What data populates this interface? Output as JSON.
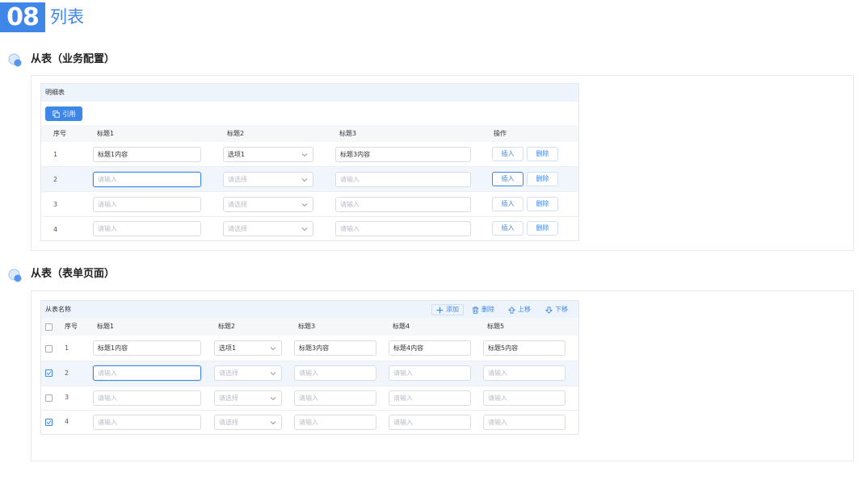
{
  "page": {
    "number": "08",
    "title": "列表"
  },
  "section1": {
    "title": "从表（业务配置）",
    "table_label": "明细表",
    "cite_button": "引用",
    "columns": [
      "序号",
      "标题1",
      "标题2",
      "标题3",
      "操作"
    ],
    "rows": [
      {
        "no": "1",
        "c1": "标题1内容",
        "c2": "选项1",
        "c3": "标题3内容",
        "insert": "插入",
        "delete": "删除"
      },
      {
        "no": "2",
        "c1": "请输入",
        "c2": "请选择",
        "c3": "请输入",
        "insert": "插入",
        "delete": "删除"
      },
      {
        "no": "3",
        "c1": "请输入",
        "c2": "请选择",
        "c3": "请输入",
        "insert": "插入",
        "delete": "删除"
      },
      {
        "no": "4",
        "c1": "请输入",
        "c2": "请选择",
        "c3": "请输入",
        "insert": "插入",
        "delete": "删除"
      }
    ]
  },
  "section2": {
    "title": "从表（表单页面）",
    "table_label": "从表名称",
    "toolbar": {
      "add": "添加",
      "delete": "删除",
      "up": "上移",
      "down": "下移"
    },
    "columns": [
      "序号",
      "标题1",
      "标题2",
      "标题3",
      "标题4",
      "标题5"
    ],
    "rows": [
      {
        "no": "1",
        "checked": false,
        "c1": "标题1内容",
        "c2": "选项1",
        "c3": "标题3内容",
        "c4": "标题4内容",
        "c5": "标题5内容"
      },
      {
        "no": "2",
        "checked": true,
        "c1": "请输入",
        "c2": "请选择",
        "c3": "请输入",
        "c4": "请输入",
        "c5": "请输入"
      },
      {
        "no": "3",
        "checked": false,
        "c1": "请输入",
        "c2": "请选择",
        "c3": "请输入",
        "c4": "请输入",
        "c5": "请输入"
      },
      {
        "no": "4",
        "checked": true,
        "c1": "请输入",
        "c2": "请选择",
        "c3": "请输入",
        "c4": "请输入",
        "c5": "请输入"
      }
    ]
  },
  "colors": {
    "accent": "#3e86e8",
    "row_highlight": "#f1f6fd",
    "header_bar": "#eef4fb"
  },
  "icons": {
    "section": "bubble-icon",
    "cite": "copy-icon",
    "select": "chevron-down-icon",
    "add": "plus-icon",
    "delete": "trash-icon",
    "up": "arrow-up-icon",
    "down": "arrow-down-icon"
  }
}
